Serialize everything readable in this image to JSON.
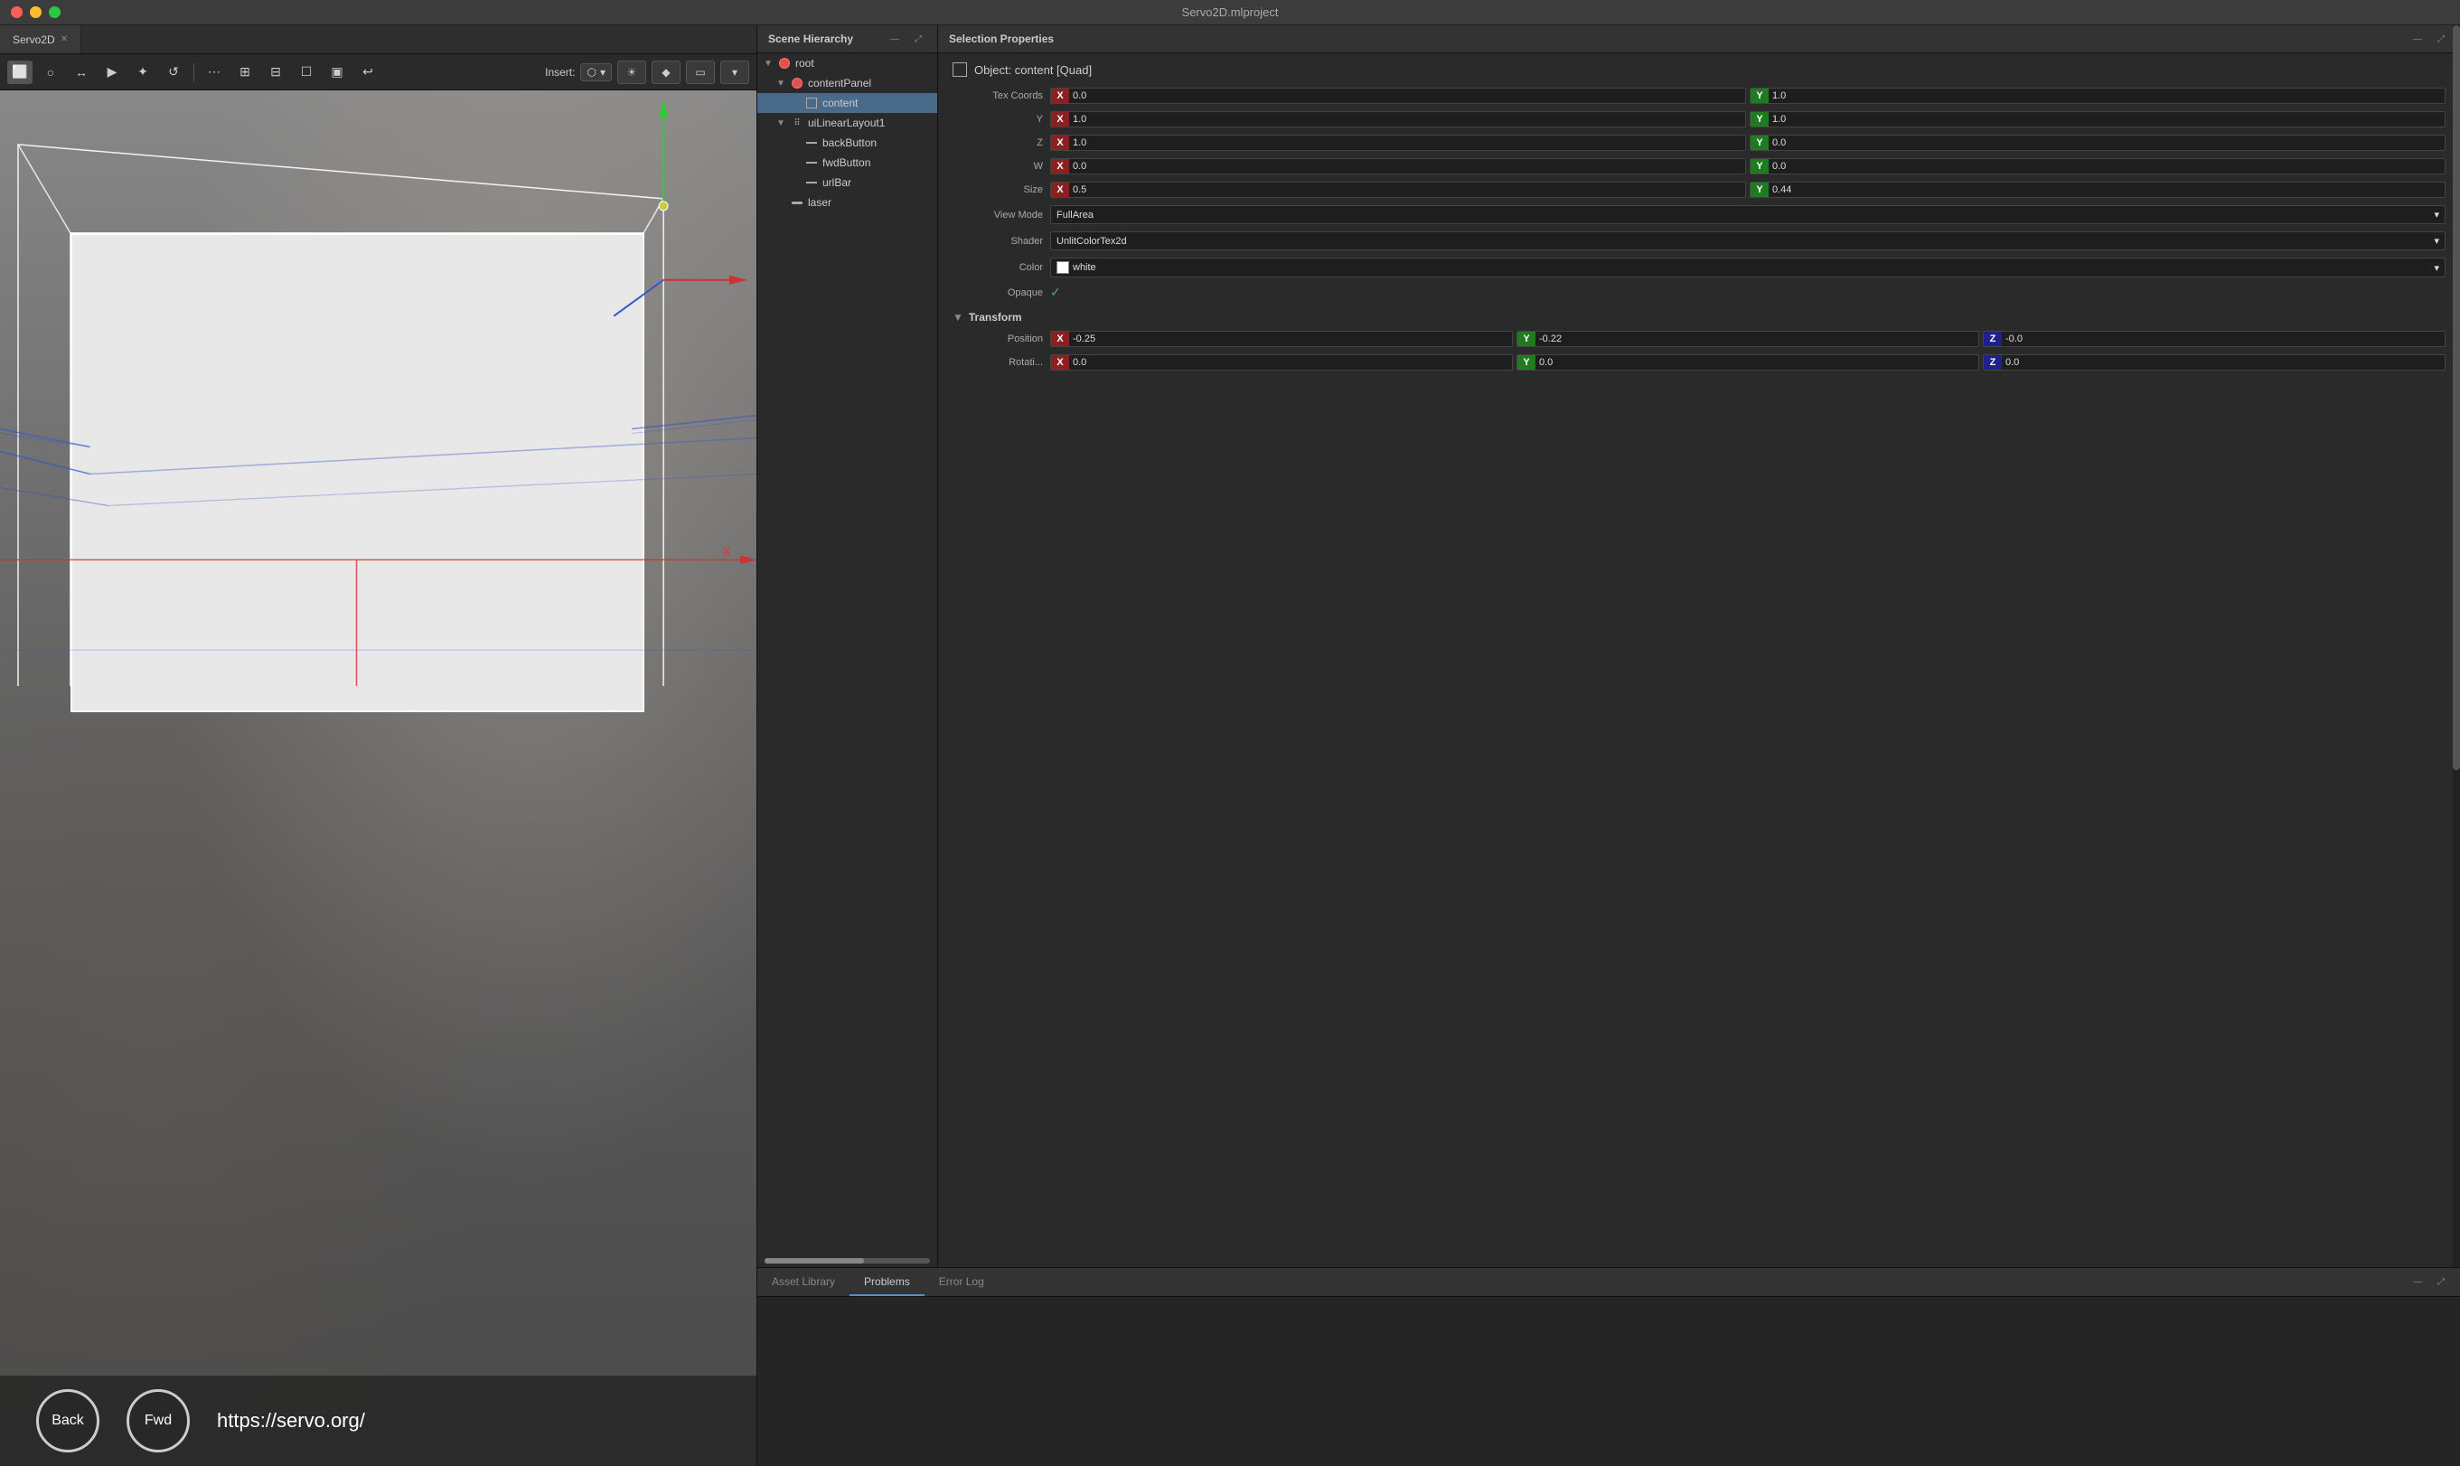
{
  "window": {
    "title": "Servo2D.mlproject"
  },
  "tabs": [
    {
      "label": "Servo2D",
      "active": true
    }
  ],
  "toolbar": {
    "insert_label": "Insert:",
    "buttons": [
      "⬜",
      "○",
      "↔",
      "▶",
      "✦",
      "↺",
      "⋯",
      "⊞",
      "⊟",
      "☐",
      "⊠",
      "□",
      "▣",
      "↩"
    ]
  },
  "viewport": {
    "url": "https://servo.org/",
    "nav_back": "Back",
    "nav_fwd": "Fwd"
  },
  "scene_hierarchy": {
    "title": "Scene Hierarchy",
    "items": [
      {
        "id": "root",
        "label": "root",
        "indent": 0,
        "type": "root",
        "expanded": true
      },
      {
        "id": "contentPanel",
        "label": "contentPanel",
        "indent": 1,
        "type": "root",
        "expanded": true
      },
      {
        "id": "content",
        "label": "content",
        "indent": 2,
        "type": "square",
        "selected": true
      },
      {
        "id": "uiLinearLayout1",
        "label": "uiLinearLayout1",
        "indent": 1,
        "type": "dots",
        "expanded": true
      },
      {
        "id": "backButton",
        "label": "backButton",
        "indent": 2,
        "type": "line"
      },
      {
        "id": "fwdButton",
        "label": "fwdButton",
        "indent": 2,
        "type": "line"
      },
      {
        "id": "urlBar",
        "label": "urlBar",
        "indent": 2,
        "type": "line"
      },
      {
        "id": "laser",
        "label": "laser",
        "indent": 1,
        "type": "line"
      }
    ]
  },
  "selection_properties": {
    "title": "Selection Properties",
    "object_label": "Object: content [Quad]",
    "tex_coords": {
      "label": "Tex Coords",
      "x": {
        "x_val": "0.0",
        "y_val": "1.0"
      },
      "y": {
        "x_val": "1.0",
        "y_val": "1.0"
      },
      "z": {
        "x_val": "1.0",
        "y_val": "0.0"
      },
      "w": {
        "x_val": "0.0",
        "y_val": "0.0"
      }
    },
    "size": {
      "label": "Size",
      "x_val": "0.5",
      "y_val": "0.44"
    },
    "view_mode": {
      "label": "View Mode",
      "value": "FullArea"
    },
    "shader": {
      "label": "Shader",
      "value": "UnlitColorTex2d"
    },
    "color": {
      "label": "Color",
      "value": "white",
      "swatch": "#ffffff"
    },
    "opaque": {
      "label": "Opaque",
      "checked": true
    },
    "transform": {
      "title": "Transform",
      "position": {
        "label": "Position",
        "x_val": "-0.25",
        "y_val": "-0.22",
        "z_val": "-0.0"
      },
      "rotation": {
        "label": "Rotati...",
        "x_val": "0.0",
        "y_val": "0.0",
        "z_val": "0.0"
      }
    }
  },
  "bottom_tabs": [
    {
      "label": "Asset Library",
      "active": false
    },
    {
      "label": "Problems",
      "active": true
    },
    {
      "label": "Error Log",
      "active": false
    }
  ]
}
